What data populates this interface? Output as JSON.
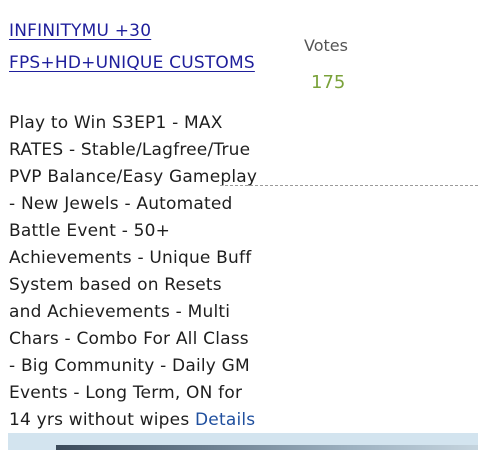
{
  "listing": {
    "title": "INFINITYMU +30 FPS+HD+UNIQUE CUSTOMS",
    "description": "Play to Win S3EP1 - MAX RATES - Stable/Lagfree/True PVP Balance/Easy Gameplay - New Jewels - Automated Battle Event - 50+ Achievements - Unique Buff System based on Resets and Achievements - Multi Chars - Combo For All Class - Big Community - Daily GM Events - Long Term, ON for 14 yrs without wipes",
    "details_label": "Details",
    "votes_label": "Votes",
    "votes_count": "175"
  }
}
